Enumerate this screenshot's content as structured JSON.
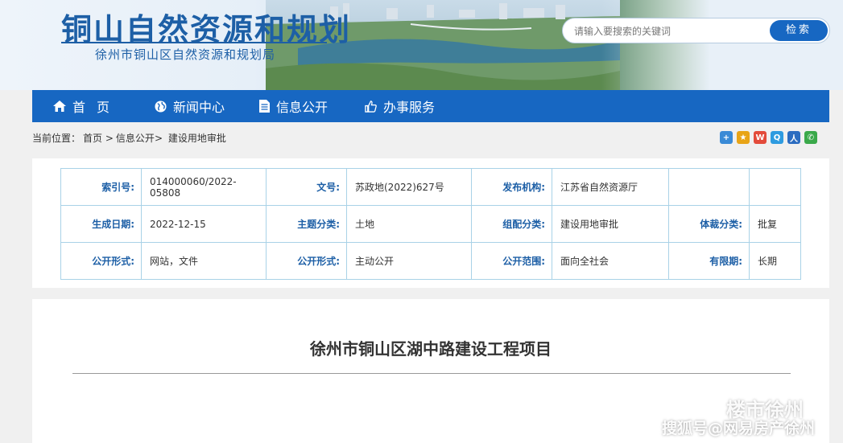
{
  "header": {
    "title": "铜山自然资源和规划",
    "subtitle": "徐州市铜山区自然资源和规划局"
  },
  "search": {
    "placeholder": "请输入要搜索的关键词",
    "button_label": "检索"
  },
  "nav": {
    "items": [
      {
        "label": "首页",
        "icon": "home-icon"
      },
      {
        "label": "新闻中心",
        "icon": "globe-icon"
      },
      {
        "label": "信息公开",
        "icon": "document-icon"
      },
      {
        "label": "办事服务",
        "icon": "thumbs-up-icon"
      }
    ]
  },
  "breadcrumb": {
    "prefix": "当前位置：",
    "items": [
      "首页",
      "信息公开",
      "建设用地审批"
    ]
  },
  "share_icons": [
    "plus-share-icon",
    "star-share-icon",
    "weibo-share-icon",
    "qq-share-icon",
    "renren-share-icon",
    "wechat-share-icon"
  ],
  "meta": {
    "rows": [
      [
        {
          "key": "索引号:",
          "value": "014000060/2022-05808"
        },
        {
          "key": "文号:",
          "value": "苏政地(2022)627号"
        },
        {
          "key": "发布机构:",
          "value": "江苏省自然资源厅"
        },
        {
          "key": "",
          "value": ""
        }
      ],
      [
        {
          "key": "生成日期:",
          "value": "2022-12-15"
        },
        {
          "key": "主题分类:",
          "value": "土地"
        },
        {
          "key": "组配分类:",
          "value": "建设用地审批"
        },
        {
          "key": "体裁分类:",
          "value": "批复"
        }
      ],
      [
        {
          "key": "公开形式:",
          "value": "网站，文件"
        },
        {
          "key": "公开形式:",
          "value": "主动公开"
        },
        {
          "key": "公开范围:",
          "value": "面向全社会"
        },
        {
          "key": "有限期:",
          "value": "长期"
        }
      ]
    ]
  },
  "article": {
    "title": "徐州市铜山区湖中路建设工程项目"
  },
  "watermark": {
    "line1": "楼市徐州",
    "line2": "搜狐号@网易房产徐州"
  },
  "colors": {
    "brand_blue": "#1767c2",
    "title_blue": "#1d5fa6",
    "table_border": "#a9d2e7"
  }
}
